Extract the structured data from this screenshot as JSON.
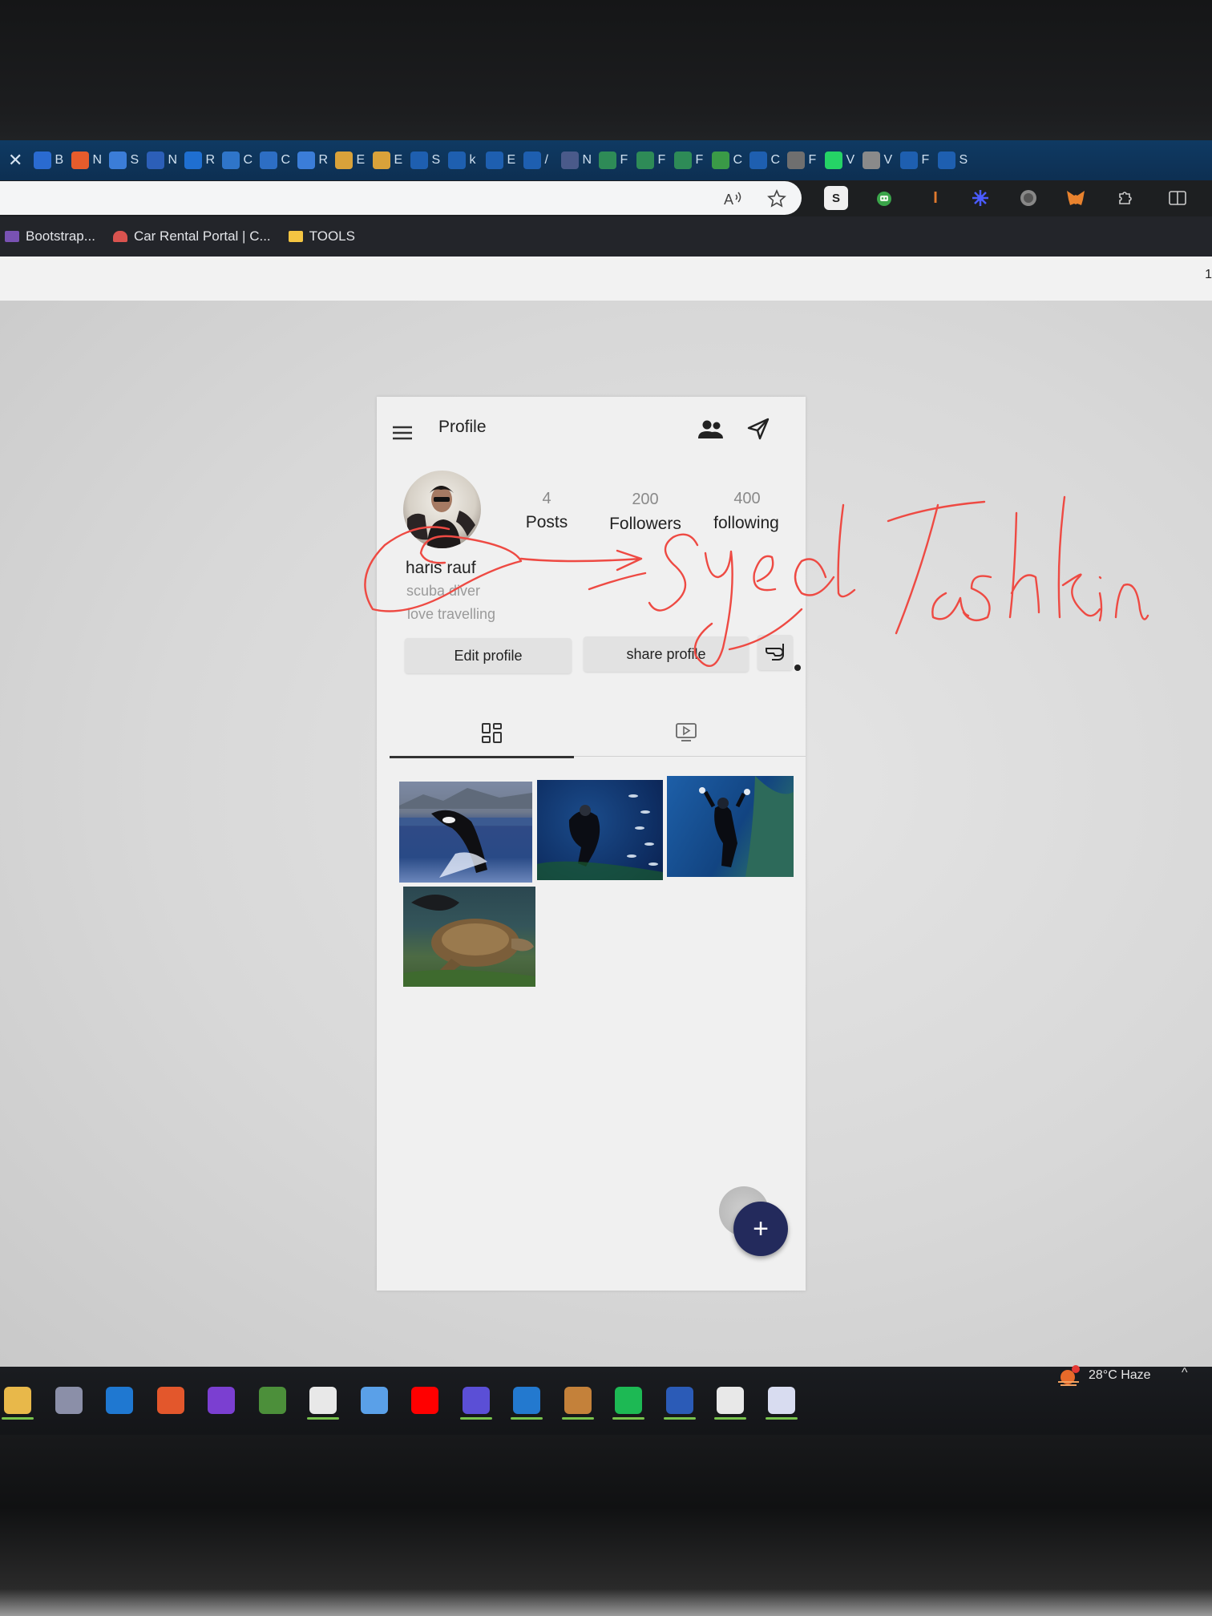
{
  "browser": {
    "tab_letters": [
      "B",
      "N",
      "S",
      "N",
      "R",
      "C",
      "C",
      "R",
      "E",
      "E",
      "S",
      "k",
      "E",
      "/",
      "N",
      "F",
      "F",
      "F",
      "C",
      "C",
      "F",
      "V",
      "V",
      "F",
      "S"
    ],
    "close_glyph": "✕",
    "bookmarks": [
      {
        "label": "Bootstrap...",
        "icon": "bootstrap-icon",
        "color": "#7952b3"
      },
      {
        "label": "Car Rental Portal | C...",
        "icon": "car-icon",
        "color": "#d9534f"
      },
      {
        "label": "TOOLS",
        "icon": "folder-icon",
        "color": "#f4c542"
      }
    ],
    "extensions": [
      "read-aloud-icon",
      "favorite-star-icon",
      "s-extension-icon",
      "robot-extension-icon",
      "cursor-extension-icon",
      "gear-extension-icon",
      "circle-extension-icon",
      "metamask-icon",
      "puzzle-extensions-icon",
      "split-screen-icon"
    ],
    "ext_s_label": "S",
    "page_strip_number": "1"
  },
  "app": {
    "title": "Profile",
    "icons": {
      "menu": "menu-icon",
      "people": "people-icon",
      "send": "send-icon"
    },
    "stats": [
      {
        "value": "4",
        "label": "Posts"
      },
      {
        "value": "200",
        "label": "Followers"
      },
      {
        "value": "400",
        "label": "following"
      }
    ],
    "profile": {
      "name": "haris rauf",
      "bio_line1": "scuba diver",
      "bio_line2": "love travelling"
    },
    "buttons": {
      "edit": "Edit profile",
      "share": "share profile",
      "dive_icon": "snorkel-icon"
    },
    "tabs": [
      {
        "icon": "grid-icon",
        "active": true
      },
      {
        "icon": "video-icon",
        "active": false
      }
    ],
    "posts": [
      {
        "subject": "orca breaching"
      },
      {
        "subject": "diver with fish"
      },
      {
        "subject": "diver on reef"
      },
      {
        "subject": "sea turtle"
      }
    ],
    "fab_label": "+"
  },
  "annotation": {
    "handwritten_text": "Syed Tashkin",
    "ink_color": "#ee4a43"
  },
  "taskbar": {
    "apps": [
      "file-explorer-icon",
      "store-icon",
      "mail-icon",
      "xampp-icon",
      "visual-studio-icon",
      "paint-icon",
      "chrome-icon",
      "snipping-icon",
      "youtube-icon",
      "azure-icon",
      "vscode-icon",
      "box-icon",
      "spotify-icon",
      "word-icon",
      "chrome-alt-icon",
      "xcode-icon"
    ],
    "weather": "28°C  Haze",
    "tray_chevron": "^"
  }
}
